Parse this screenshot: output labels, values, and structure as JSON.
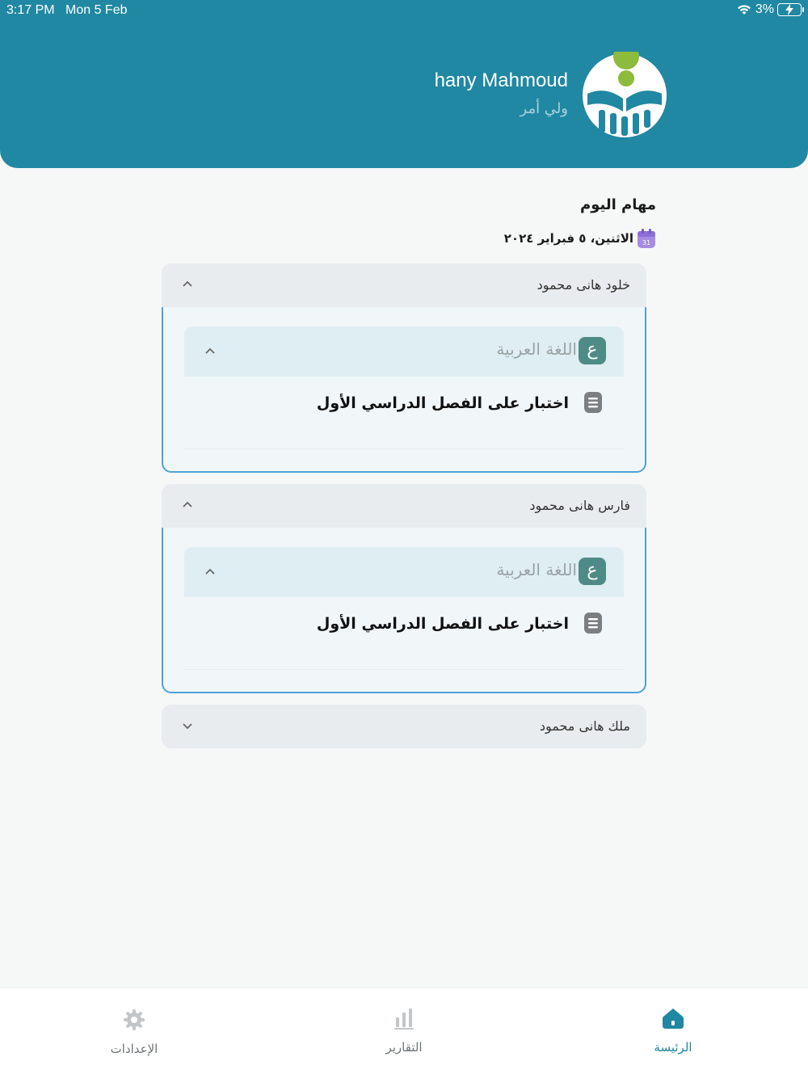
{
  "status_bar": {
    "time": "3:17 PM",
    "date": "Mon 5 Feb",
    "battery": "3%"
  },
  "user": {
    "name": "hany Mahmoud",
    "role": "ولي أمر"
  },
  "tasks_section": {
    "title": "مهام اليوم",
    "date": "الاثنين، ٥ فبراير ٢٠٢٤",
    "calendar_day": "31"
  },
  "students": [
    {
      "name": "خلود هانى محمود",
      "expanded": true,
      "subject": {
        "badge": "ع",
        "label": "اللغة العربية"
      },
      "task": "اختبار على الفصل الدراسي الأول"
    },
    {
      "name": "فارس هانى محمود",
      "expanded": true,
      "subject": {
        "badge": "ع",
        "label": "اللغة العربية"
      },
      "task": "اختبار على الفصل الدراسي الأول"
    },
    {
      "name": "ملك هانى محمود",
      "expanded": false
    }
  ],
  "nav": {
    "home": "الرئيسة",
    "reports": "التقارير",
    "settings": "الإعدادات",
    "active": "home"
  },
  "colors": {
    "primary": "#2088a2",
    "card_border": "#4fa2d6",
    "subject_badge": "#4f8b86"
  }
}
